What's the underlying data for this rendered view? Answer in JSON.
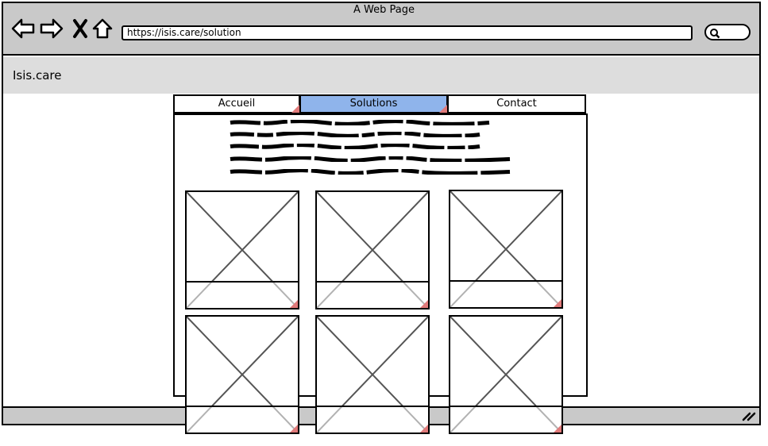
{
  "window": {
    "title": "A Web Page"
  },
  "toolbar": {
    "url": "https://isis.care/solution",
    "icons": [
      "back-arrow-icon",
      "forward-arrow-icon",
      "close-icon",
      "home-icon",
      "search-icon"
    ]
  },
  "site": {
    "brand": "Isis.care"
  },
  "nav": {
    "tabs": [
      {
        "label": "Accueil",
        "active": false
      },
      {
        "label": "Solutions",
        "active": true
      },
      {
        "label": "Contact",
        "active": false
      }
    ]
  },
  "colors": {
    "chrome": "#c9c9c9",
    "header": "#dddddd",
    "active_tab": "#8fb4eb",
    "corner_mark": "#e07a7a"
  },
  "cards": {
    "count": 6
  }
}
